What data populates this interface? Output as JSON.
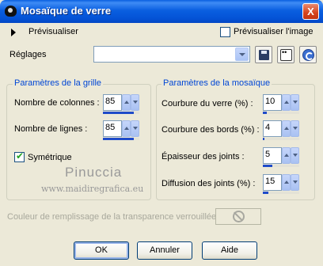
{
  "window": {
    "title": "Mosaïque de verre",
    "close_label": "X"
  },
  "preview": {
    "label": "Prévisualiser",
    "image_label": "Prévisualiser l'image",
    "image_checked": false
  },
  "settings": {
    "label": "Réglages",
    "value": ""
  },
  "grid_group": {
    "title": "Paramètres de la grille",
    "columns": {
      "label": "Nombre de colonnes :",
      "value": "85",
      "level_percent": 85
    },
    "rows": {
      "label": "Nombre de lignes :",
      "value": "85",
      "level_percent": 85
    },
    "symmetric": {
      "label": "Symétrique",
      "checked": true
    }
  },
  "mosaic_group": {
    "title": "Paramètres de la mosaïque",
    "glass_curvature": {
      "label": "Courbure du verre (%) :",
      "value": "10",
      "level_percent": 10
    },
    "edge_curvature": {
      "label": "Courbure des bords (%) :",
      "value": "4",
      "level_percent": 4
    },
    "joint_thickness": {
      "label": "Épaisseur des joints :",
      "value": "5",
      "level_percent": 25
    },
    "joint_diffusion": {
      "label": "Diffusion des joints (%) :",
      "value": "15",
      "level_percent": 15
    }
  },
  "watermark": {
    "name": "Pinuccia",
    "site": "www.maidiregrafica.eu"
  },
  "transparency": {
    "label": "Couleur de remplissage de la transparence verrouillée :"
  },
  "buttons": {
    "ok": "OK",
    "cancel": "Annuler",
    "help": "Aide"
  },
  "colors": {
    "title_bar": "#0a5fe0",
    "dialog_bg": "#ece9d8",
    "group_title": "#0046d5"
  },
  "icons": [
    "app-icon",
    "close-icon",
    "expand-arrow-icon",
    "save-icon",
    "random-icon",
    "reset-icon",
    "no-symbol-icon"
  ]
}
